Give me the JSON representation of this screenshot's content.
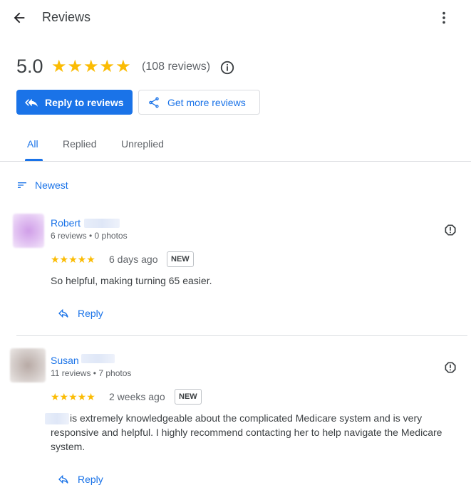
{
  "header": {
    "title": "Reviews"
  },
  "summary": {
    "rating": "5.0",
    "stars": "★★★★★",
    "review_count": "(108 reviews)"
  },
  "actions": {
    "reply_label": "Reply to reviews",
    "get_more_label": "Get more reviews"
  },
  "tabs": [
    {
      "label": "All"
    },
    {
      "label": "Replied"
    },
    {
      "label": "Unreplied"
    }
  ],
  "sort": {
    "label": "Newest"
  },
  "reviews": [
    {
      "name": "Robert",
      "meta": "6 reviews • 0 photos",
      "stars": "★★★★★",
      "rating": 5,
      "age": "6 days ago",
      "badge": "NEW",
      "text": "So helpful, making turning 65 easier.",
      "reply_label": "Reply"
    },
    {
      "name": "Susan",
      "meta": "11 reviews • 7 photos",
      "stars": "★★★★★",
      "rating": 5,
      "age": "2 weeks ago",
      "badge": "NEW",
      "text_line1": "is extremely knowledgeable about the complicated Medicare system and is very",
      "text_line2": "responsive and helpful. I highly recommend contacting her to help navigate the Medicare",
      "text_line3": "system.",
      "reply_label": "Reply"
    }
  ],
  "colors": {
    "accent": "#1a73e8",
    "star": "#fbbc04"
  }
}
